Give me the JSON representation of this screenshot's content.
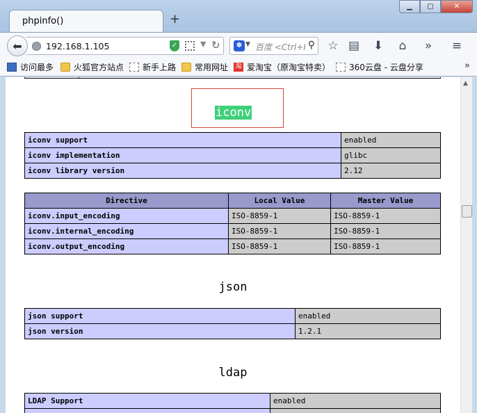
{
  "browser": {
    "tab_title": "phpinfo()",
    "new_tab_label": "+",
    "url": "192.168.1.105",
    "search_placeholder": "百度 <Ctrl+K>",
    "bookmarks": [
      "访问最多",
      "火狐官方站点",
      "新手上路",
      "常用网址",
      "爱淘宝（原淘宝特卖）",
      "360云盘 - 云盘分享"
    ]
  },
  "iconv": {
    "title": "iconv",
    "info_rows": [
      {
        "name": "iconv support",
        "value": "enabled"
      },
      {
        "name": "iconv implementation",
        "value": "glibc"
      },
      {
        "name": "iconv library version",
        "value": "2.12"
      }
    ],
    "directive_headers": [
      "Directive",
      "Local Value",
      "Master Value"
    ],
    "directives": [
      {
        "name": "iconv.input_encoding",
        "local": "ISO-8859-1",
        "master": "ISO-8859-1"
      },
      {
        "name": "iconv.internal_encoding",
        "local": "ISO-8859-1",
        "master": "ISO-8859-1"
      },
      {
        "name": "iconv.output_encoding",
        "local": "ISO-8859-1",
        "master": "ISO-8859-1"
      }
    ]
  },
  "json": {
    "title": "json",
    "rows": [
      {
        "name": "json support",
        "value": "enabled"
      },
      {
        "name": "json version",
        "value": "1.2.1"
      }
    ]
  },
  "ldap": {
    "title": "ldap",
    "rows": [
      {
        "name": "LDAP Support",
        "value": "enabled"
      }
    ]
  }
}
